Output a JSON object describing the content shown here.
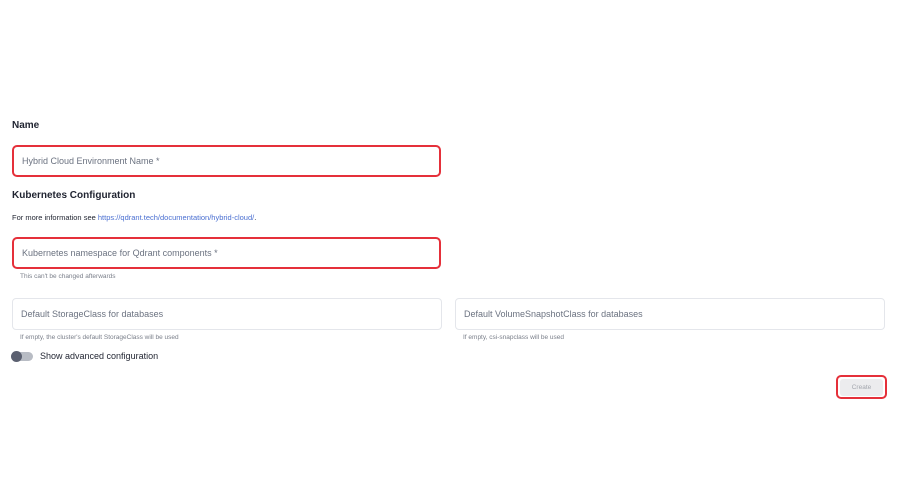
{
  "name_section": {
    "title": "Name",
    "env_name_field": {
      "placeholder": "Hybrid Cloud Environment Name *",
      "value": ""
    }
  },
  "k8s_section": {
    "title": "Kubernetes Configuration",
    "info_prefix": "For more information see",
    "info_link": "https://qdrant.tech/documentation/hybrid-cloud/",
    "info_suffix": ".",
    "namespace_field": {
      "placeholder": "Kubernetes namespace for Qdrant components *",
      "value": ""
    },
    "namespace_helper": "This can't be changed afterwards",
    "storage_class_field": {
      "placeholder": "Default StorageClass for databases",
      "value": ""
    },
    "storage_class_helper": "If empty, the cluster's default StorageClass will be used",
    "snapshot_class_field": {
      "placeholder": "Default VolumeSnapshotClass for databases",
      "value": ""
    },
    "snapshot_class_helper": "If empty, csi-snapclass will be used"
  },
  "advanced": {
    "label": "Show advanced configuration",
    "enabled": false
  },
  "actions": {
    "create_label": "Create"
  },
  "colors": {
    "highlight": "#e5303a",
    "link": "#4a6fd1",
    "button_disabled_bg": "#ececee"
  }
}
